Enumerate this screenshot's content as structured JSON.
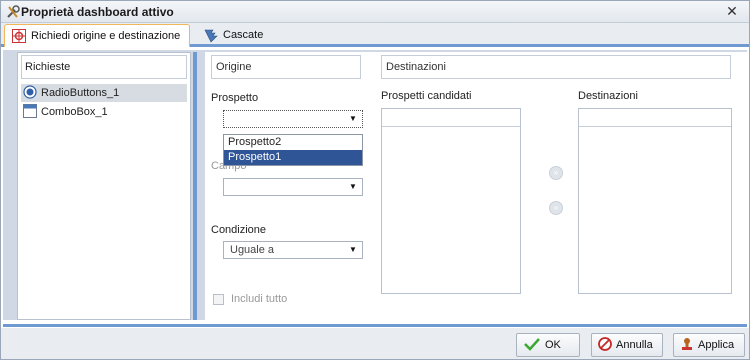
{
  "window": {
    "title": "Proprietà dashboard attivo",
    "icon": "tools-icon",
    "close_label": "✕"
  },
  "tabs": [
    {
      "label": "Richiedi origine e destinazione",
      "icon": "target-icon",
      "active": true
    },
    {
      "label": "Cascate",
      "icon": "cascade-icon",
      "active": false
    }
  ],
  "left_panel": {
    "header": "Richieste",
    "items": [
      {
        "label": "RadioButtons_1",
        "icon": "radio-icon",
        "selected": true
      },
      {
        "label": "ComboBox_1",
        "icon": "combobox-icon",
        "selected": false
      }
    ]
  },
  "origin": {
    "header": "Origine",
    "prospetto_label": "Prospetto",
    "prospetto_value": "",
    "prospetto_options": [
      "Prospetto2",
      "Prospetto1"
    ],
    "prospetto_selected": "Prospetto1",
    "campo_label": "Campo",
    "campo_value": "",
    "condizione_label": "Condizione",
    "condizione_value": "Uguale a",
    "includi_label": "Includi tutto",
    "includi_checked": false
  },
  "destination": {
    "header": "Destinazioni",
    "candidates_label": "Prospetti candidati",
    "destinations_label": "Destinazioni",
    "add_symbol": "»",
    "remove_symbol": "«"
  },
  "footer": {
    "ok_label": "OK",
    "cancel_label": "Annulla",
    "apply_label": "Applica"
  },
  "colors": {
    "accent": "#6f9ad1",
    "selection": "#2f5597",
    "tab_highlight": "#f0b65a"
  }
}
